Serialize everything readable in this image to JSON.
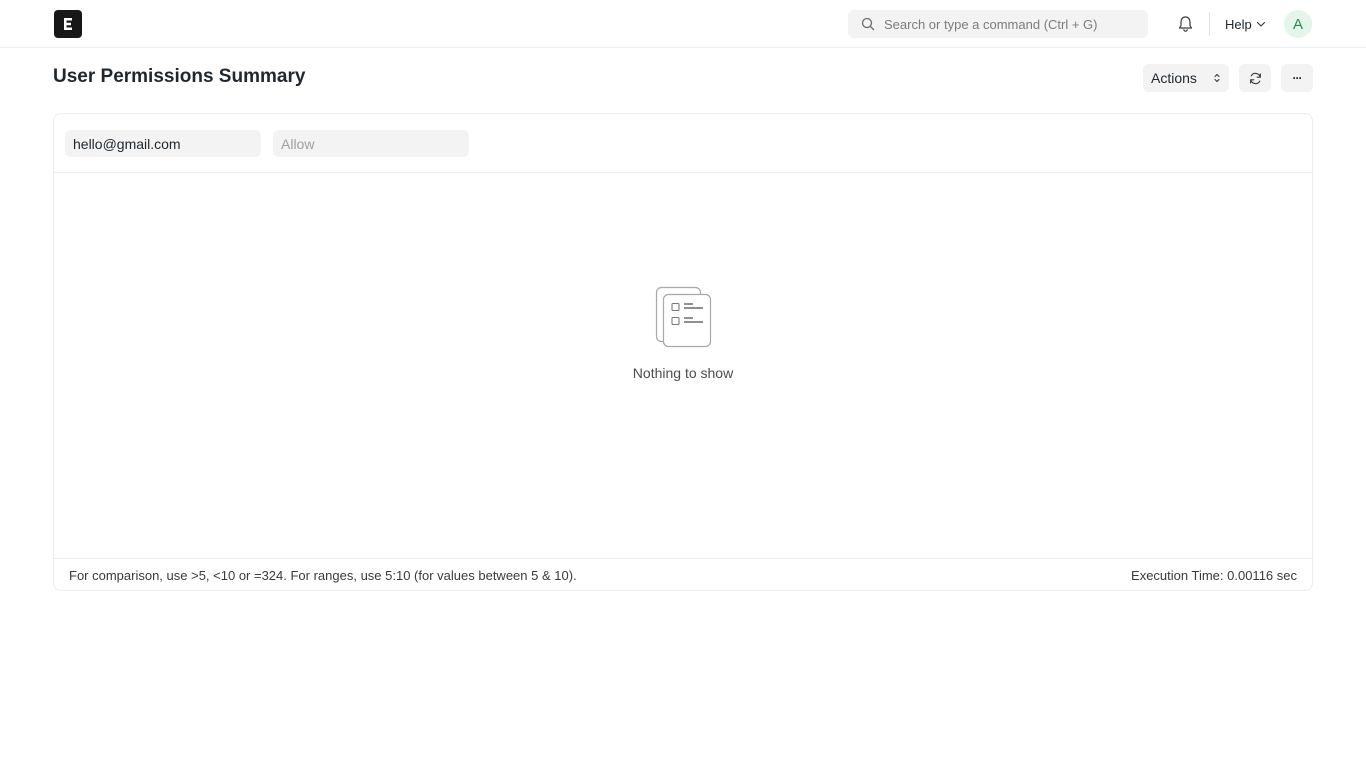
{
  "navbar": {
    "logo_letter": "E",
    "search_placeholder": "Search or type a command (Ctrl + G)",
    "help_label": "Help",
    "avatar_initial": "A",
    "avatar_color": "#2a8a4e",
    "avatar_bg": "#e4f5e9"
  },
  "page": {
    "title": "User Permissions Summary",
    "actions_label": "Actions",
    "more_label": "···"
  },
  "filters": {
    "user_value": "hello@gmail.com",
    "allow_placeholder": "Allow"
  },
  "results": {
    "empty_message": "Nothing to show"
  },
  "footer": {
    "hint": "For comparison, use >5, <10 or =324. For ranges, use 5:10 (for values between 5 & 10).",
    "execution_time": "Execution Time: 0.00116 sec"
  },
  "icons": {
    "logo": "app-logo-icon",
    "search": "search-icon",
    "notifications": "bell-icon",
    "help_dropdown": "chevron-down-icon",
    "actions_dropdown": "chevron-up-down-icon",
    "refresh": "refresh-icon",
    "more": "more-icon",
    "empty": "empty-list-icon"
  }
}
